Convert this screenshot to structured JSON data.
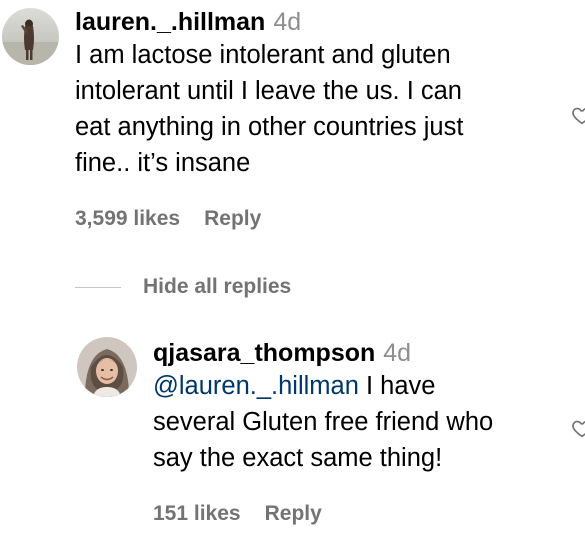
{
  "comments": [
    {
      "username": "lauren._.hillman",
      "time": "4d",
      "text": "I am lactose intolerant and gluten\nintolerant until I leave the us. I can\neat anything in other countries just\nfine.. it’s insane",
      "likes": "3,599 likes",
      "reply_label": "Reply"
    }
  ],
  "replies_toggle": {
    "label": "Hide all replies"
  },
  "replies": [
    {
      "username": "qjasara_thompson",
      "time": "4d",
      "mention": "@lauren._.hillman",
      "text": " I have\nseveral Gluten free friend who\nsay the exact same thing!",
      "likes": "151 likes",
      "reply_label": "Reply"
    }
  ],
  "icons": {
    "like": "heart-icon"
  },
  "colors": {
    "text": "#000000",
    "secondary": "#737373",
    "timestamp": "#8e8e8e",
    "mention": "#00376b"
  }
}
